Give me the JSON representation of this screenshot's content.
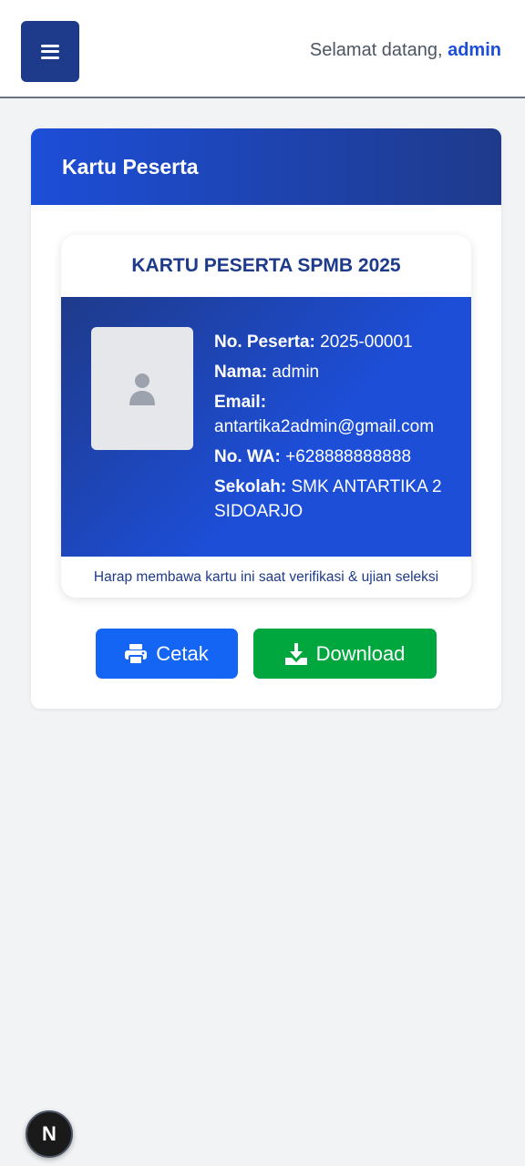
{
  "header": {
    "welcome_prefix": "Selamat datang,",
    "username": "admin"
  },
  "panel": {
    "title": "Kartu Peserta"
  },
  "card": {
    "title": "KARTU PESERTA SPMB 2025",
    "fields": [
      {
        "label": "No. Peserta:",
        "value": "2025-00001"
      },
      {
        "label": "Nama:",
        "value": "admin"
      },
      {
        "label": "Email:",
        "value": "antartika2admin@gmail.com"
      },
      {
        "label": "No. WA:",
        "value": "+628888888888"
      },
      {
        "label": "Sekolah:",
        "value": "SMK ANTARTIKA 2 SIDOARJO"
      }
    ],
    "footer_note": "Harap membawa kartu ini saat verifikasi & ujian seleksi"
  },
  "actions": {
    "print_label": "Cetak",
    "download_label": "Download"
  },
  "badge": {
    "letter": "N"
  },
  "icons": {
    "menu": "hamburger-icon",
    "photo": "user-icon",
    "print": "printer-icon",
    "download": "download-icon"
  },
  "colors": {
    "primary": "#1e3a8a",
    "accent": "#1d4ed8",
    "print_button": "#1565f5",
    "download_button": "#00a63e"
  }
}
